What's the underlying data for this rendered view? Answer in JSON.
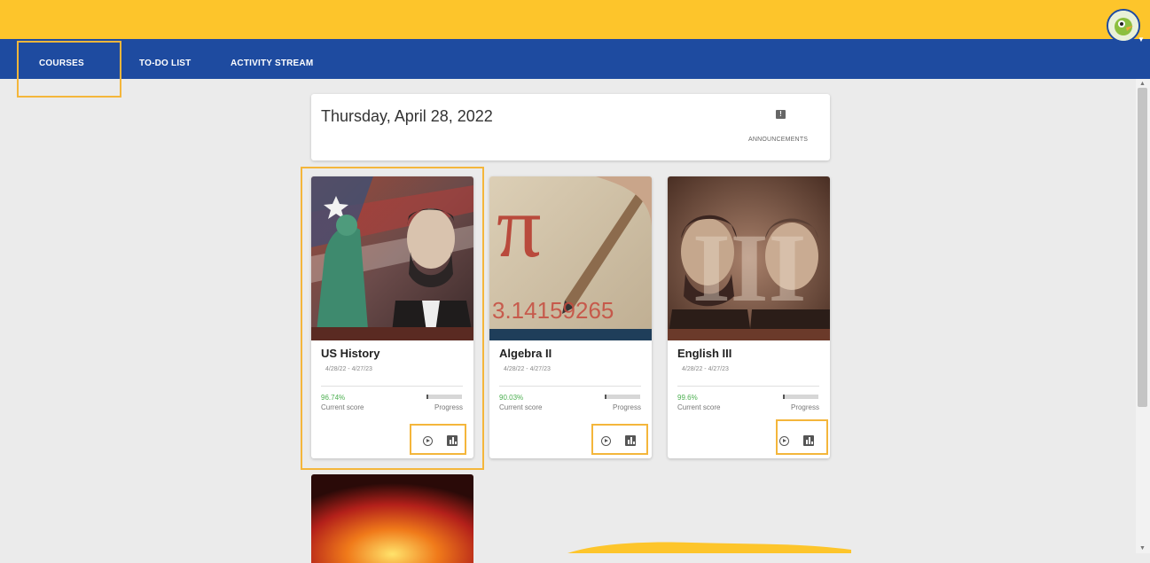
{
  "nav": {
    "tabs": [
      {
        "label": "COURSES",
        "active": true
      },
      {
        "label": "TO-DO LIST",
        "active": false
      },
      {
        "label": "ACTIVITY STREAM",
        "active": false
      }
    ]
  },
  "header": {
    "date": "Thursday, April 28, 2022",
    "announcements_label": "ANNOUNCEMENTS",
    "announcements_icon": "announcement-icon"
  },
  "courses": [
    {
      "title": "US History",
      "dates": "4/28/22 - 4/27/23",
      "score": "96.74%",
      "score_label": "Current score",
      "progress_label": "Progress"
    },
    {
      "title": "Algebra II",
      "dates": "4/28/22 - 4/27/23",
      "score": "90.03%",
      "score_label": "Current score",
      "progress_label": "Progress"
    },
    {
      "title": "English III",
      "dates": "4/28/22 - 4/27/23",
      "score": "99.6%",
      "score_label": "Current score",
      "progress_label": "Progress"
    }
  ],
  "colors": {
    "nav_blue": "#1e4ba0",
    "banner_yellow": "#fdc52b",
    "highlight": "#f4b63b",
    "score_green": "#4caf50"
  },
  "icons": [
    "play-icon",
    "stats-icon",
    "announcement-icon",
    "avatar-icon"
  ]
}
